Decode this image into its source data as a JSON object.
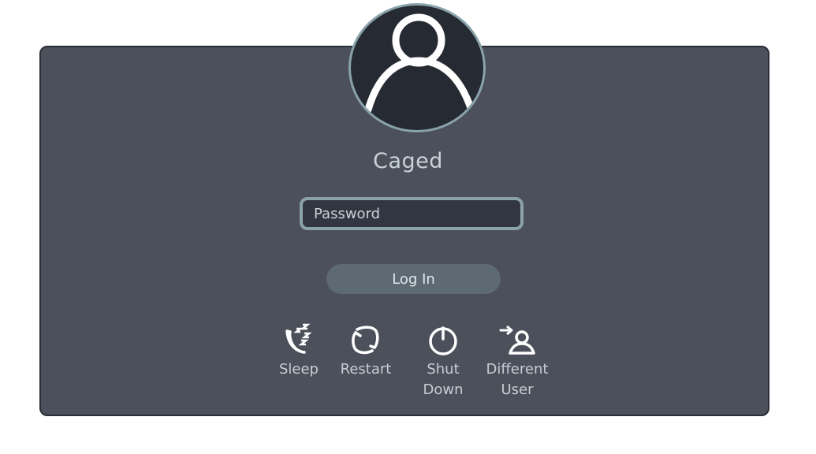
{
  "user": {
    "name": "Caged"
  },
  "password": {
    "placeholder": "Password",
    "value": ""
  },
  "login": {
    "label": "Log In"
  },
  "actions": [
    {
      "label": "Sleep",
      "icon": "sleep-icon"
    },
    {
      "label": "Restart",
      "icon": "restart-icon"
    },
    {
      "label": "Shut Down",
      "icon": "power-icon"
    },
    {
      "label": "Different User",
      "icon": "switch-user-icon"
    }
  ],
  "colors": {
    "panel": "#4c505b",
    "avatar_bg": "#262a33",
    "accent": "#8aa3ab",
    "button": "#5d6a74",
    "text": "#c9d3d8"
  }
}
